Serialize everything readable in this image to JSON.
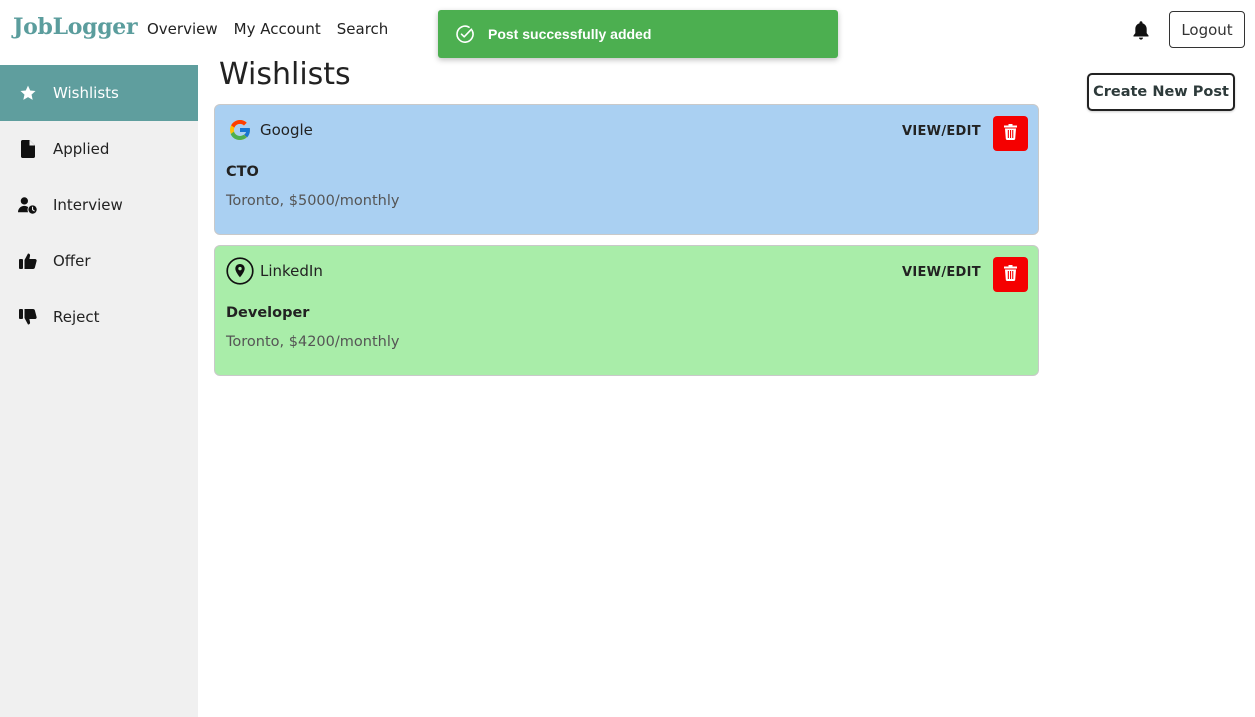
{
  "app": {
    "logo": "JobLogger"
  },
  "nav": {
    "overview": "Overview",
    "account": "My Account",
    "search": "Search"
  },
  "header": {
    "logout": "Logout",
    "bell_icon": "bell-icon"
  },
  "toast": {
    "message": "Post successfully added",
    "icon": "check-circle-icon",
    "color": "#4caf50"
  },
  "sidebar": {
    "items": [
      {
        "label": "Wishlists",
        "icon": "star-icon",
        "active": true
      },
      {
        "label": "Applied",
        "icon": "file-icon",
        "active": false
      },
      {
        "label": "Interview",
        "icon": "user-clock-icon",
        "active": false
      },
      {
        "label": "Offer",
        "icon": "thumbs-up-icon",
        "active": false
      },
      {
        "label": "Reject",
        "icon": "thumbs-down-icon",
        "active": false
      }
    ]
  },
  "main": {
    "title": "Wishlists",
    "create_label": "Create New Post",
    "posts": [
      {
        "company": "Google",
        "role": "CTO",
        "details": "Toronto, $5000/monthly",
        "view_label": "VIEW/EDIT",
        "color": "#aad0f2",
        "logo": "google-logo-icon"
      },
      {
        "company": "LinkedIn",
        "role": "Developer",
        "details": "Toronto, $4200/monthly",
        "view_label": "VIEW/EDIT",
        "color": "#a9eda9",
        "logo": "map-pin-icon"
      }
    ]
  },
  "colors": {
    "accent": "#5f9e9e",
    "delete": "#f50000",
    "sidebar_bg": "#f0f0f0"
  }
}
